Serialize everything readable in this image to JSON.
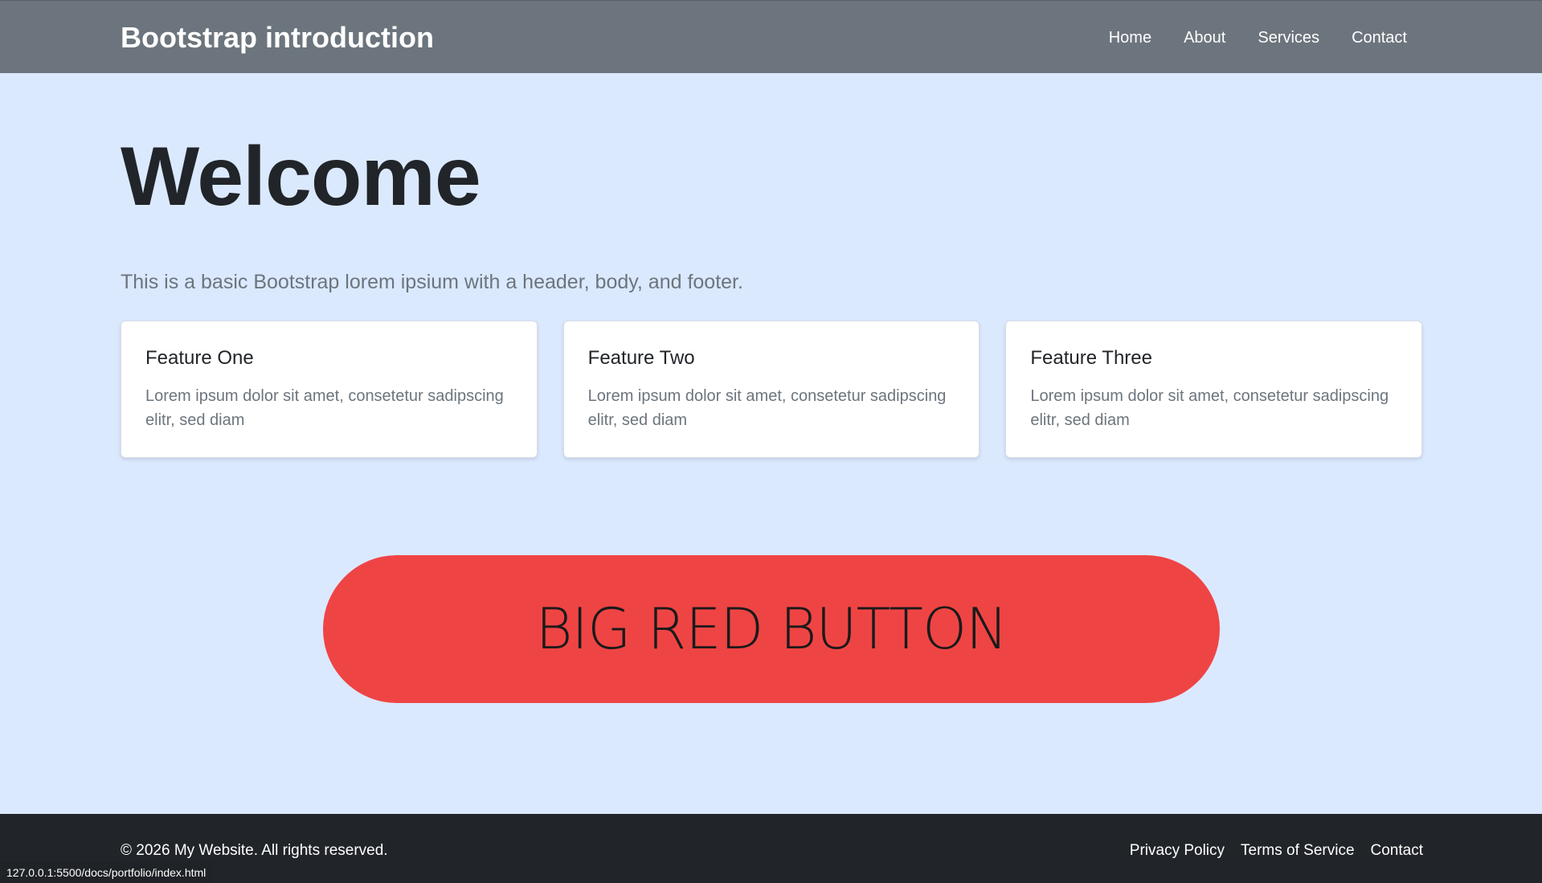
{
  "header": {
    "brand": "Bootstrap introduction",
    "nav": [
      {
        "label": "Home"
      },
      {
        "label": "About"
      },
      {
        "label": "Services"
      },
      {
        "label": "Contact"
      }
    ]
  },
  "main": {
    "title": "Welcome",
    "lead": "This is a basic Bootstrap lorem ipsium with a header, body, and footer.",
    "cards": [
      {
        "title": "Feature One",
        "text": "Lorem ipsum dolor sit amet, consetetur sadipscing elitr, sed diam"
      },
      {
        "title": "Feature Two",
        "text": "Lorem ipsum dolor sit amet, consetetur sadipscing elitr, sed diam"
      },
      {
        "title": "Feature Three",
        "text": "Lorem ipsum dolor sit amet, consetetur sadipscing elitr, sed diam"
      }
    ],
    "big_button": "BIG RED BUTTON"
  },
  "footer": {
    "copyright": "© 2026 My Website. All rights reserved.",
    "links": [
      {
        "label": "Privacy Policy"
      },
      {
        "label": "Terms of Service"
      },
      {
        "label": "Contact"
      }
    ]
  },
  "status_bar": {
    "url": "127.0.0.1:5500/docs/portfolio/index.html"
  },
  "colors": {
    "navbar_bg": "#6c757d",
    "page_bg": "#dbe9ff",
    "button_red": "#ef4444",
    "footer_bg": "#212529"
  }
}
